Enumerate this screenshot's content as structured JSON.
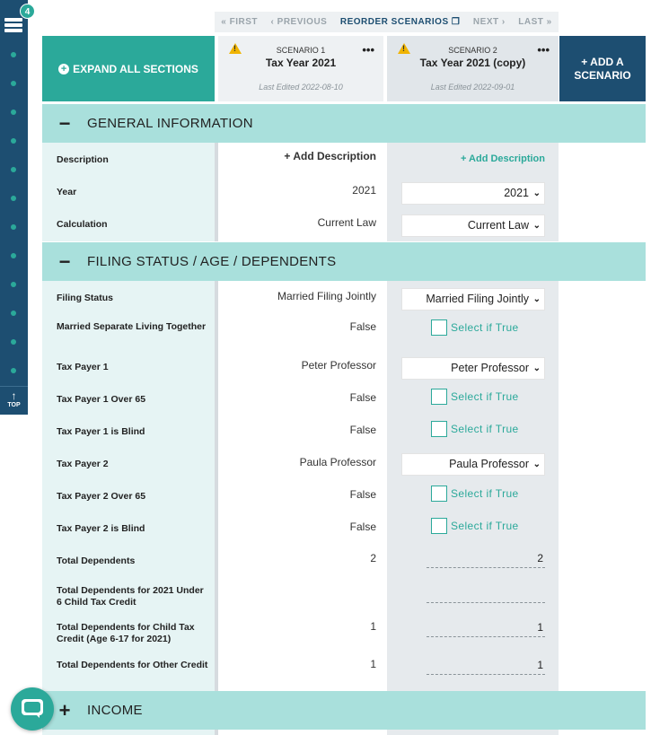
{
  "rail": {
    "badge": "4",
    "top_label": "TOP"
  },
  "pager": {
    "first": "« FIRST",
    "previous": "‹ PREVIOUS",
    "reorder": "REORDER SCENARIOS ❐",
    "next": "NEXT ›",
    "last": "LAST »"
  },
  "header": {
    "expand_label": "EXPAND ALL SECTIONS",
    "add_scenario_line1": "+ ADD A",
    "add_scenario_line2": "SCENARIO"
  },
  "scenarios": [
    {
      "sub": "SCENARIO 1",
      "name": "Tax Year 2021",
      "edited": "Last Edited 2022-08-10"
    },
    {
      "sub": "SCENARIO 2",
      "name": "Tax Year 2021 (copy)",
      "edited": "Last Edited 2022-09-01"
    }
  ],
  "sections": {
    "general": "GENERAL INFORMATION",
    "filing": "FILING STATUS / AGE / DEPENDENTS",
    "income": "INCOME"
  },
  "rows": {
    "description": {
      "label": "Description",
      "s1": "+ Add Description",
      "s2": "+ Add Description"
    },
    "year": {
      "label": "Year",
      "s1": "2021",
      "s2": "2021"
    },
    "calculation": {
      "label": "Calculation",
      "s1": "Current Law",
      "s2": "Current Law"
    },
    "filing_status": {
      "label": "Filing Status",
      "s1": "Married Filing Jointly",
      "s2": "Married Filing Jointly"
    },
    "married_sep": {
      "label": "Married Separate Living Together",
      "s1": "False",
      "s2": "Select if True"
    },
    "tp1": {
      "label": "Tax Payer 1",
      "s1": "Peter Professor",
      "s2": "Peter Professor"
    },
    "tp1_over65": {
      "label": "Tax Payer 1 Over 65",
      "s1": "False",
      "s2": "Select if True"
    },
    "tp1_blind": {
      "label": "Tax Payer 1 is Blind",
      "s1": "False",
      "s2": "Select if True"
    },
    "tp2": {
      "label": "Tax Payer 2",
      "s1": "Paula Professor",
      "s2": "Paula Professor"
    },
    "tp2_over65": {
      "label": "Tax Payer 2 Over 65",
      "s1": "False",
      "s2": "Select if True"
    },
    "tp2_blind": {
      "label": "Tax Payer 2 is Blind",
      "s1": "False",
      "s2": "Select if True"
    },
    "total_dep": {
      "label": "Total Dependents",
      "s1": "2",
      "s2": "2"
    },
    "dep_under6": {
      "label": "Total Dependents for 2021 Under 6 Child Tax Credit",
      "s1": "",
      "s2": ""
    },
    "dep_6_17": {
      "label": "Total Dependents for Child Tax Credit (Age 6-17 for 2021)",
      "s1": "1",
      "s2": "1"
    },
    "dep_other": {
      "label": "Total Dependents for Other Credit",
      "s1": "1",
      "s2": "1"
    }
  },
  "colors": {
    "teal": "#2ba99a",
    "navy": "#1d4e71",
    "section_bg": "#a9e0dc",
    "warning": "#f0b400"
  }
}
